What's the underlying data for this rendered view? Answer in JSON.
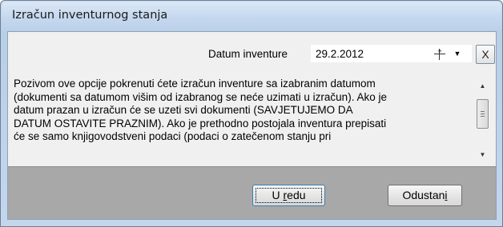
{
  "window": {
    "title": "Izračun inventurnog stanja"
  },
  "date": {
    "label": "Datum inventure",
    "value": "29.2.2012"
  },
  "close_button": {
    "label": "X"
  },
  "memo": {
    "lines": [
      "Pozivom ove opcije pokrenuti ćete izračun inventure sa izabranim datumom",
      "(dokumenti sa datumom višim od izabranog se neće uzimati u izračun). Ako je",
      "datum prazan u izračun će se uzeti svi dokumenti (SAVJETUJEMO DA",
      "DATUM OSTAVITE PRAZNIM). Ako je prethodno postojala inventura prepisati",
      "će se samo knjigovodstveni podaci (podaci o zatečenom stanju pri"
    ]
  },
  "buttons": {
    "ok": {
      "pre": "U ",
      "accel": "r",
      "post": "edu"
    },
    "cancel": {
      "pre": "Odustan",
      "accel": "i",
      "post": ""
    }
  }
}
